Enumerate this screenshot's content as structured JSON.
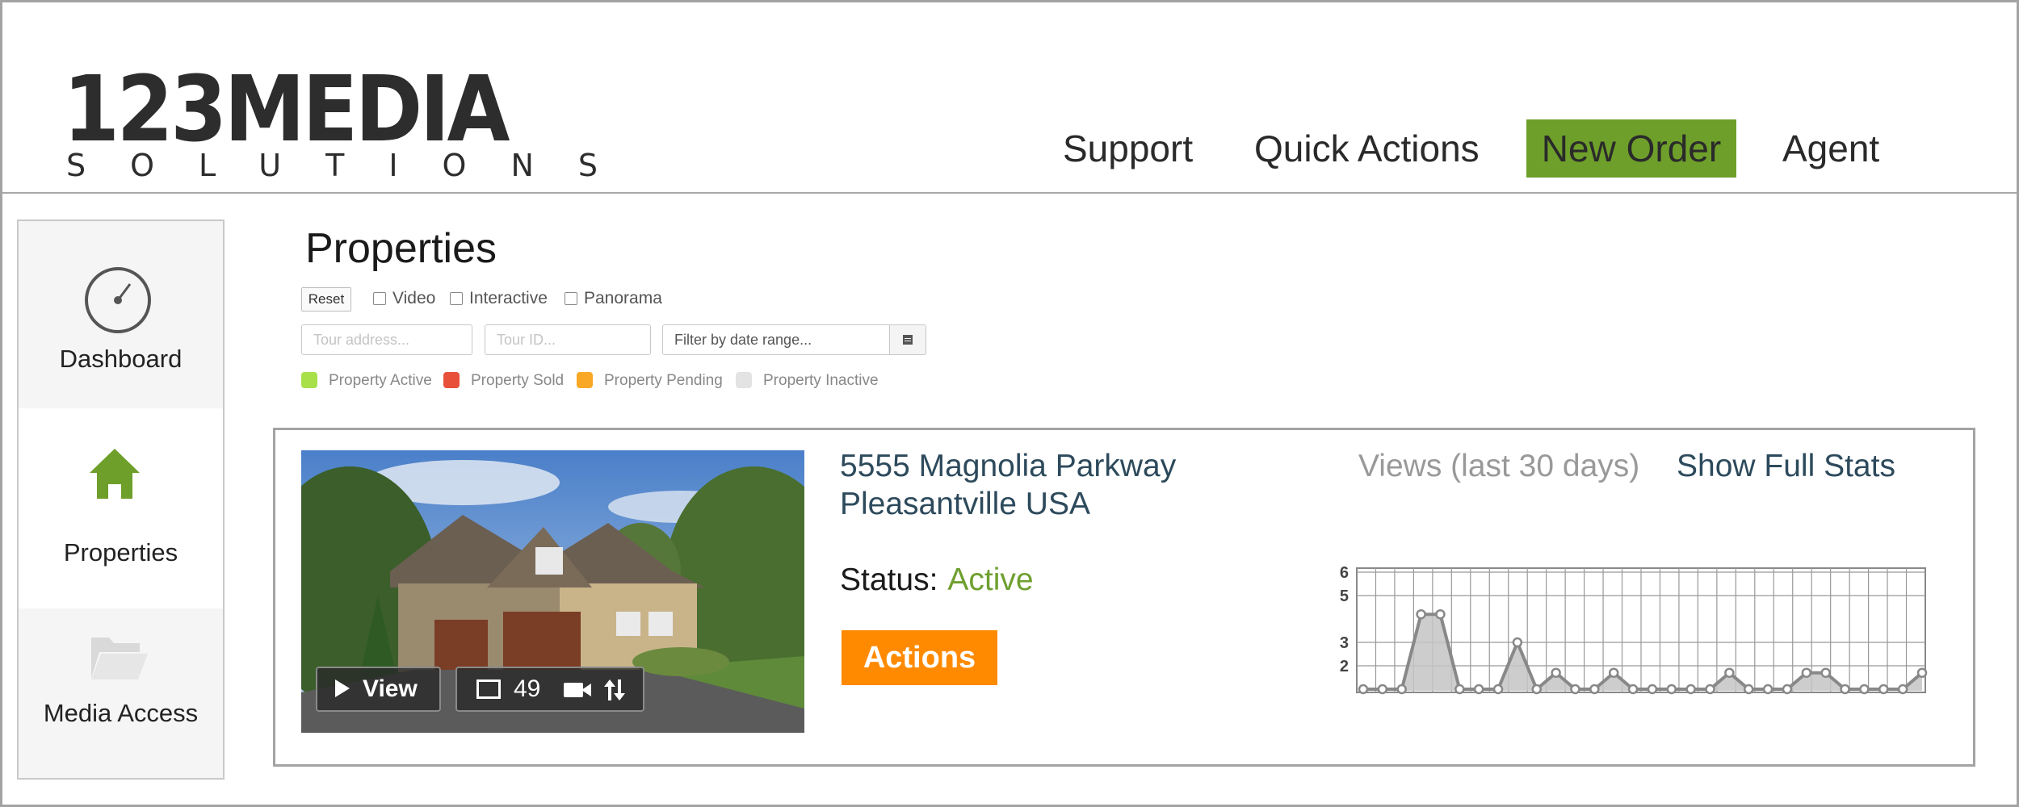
{
  "logo": {
    "top": "123MEDIA",
    "bottom": "SOLUTIONS"
  },
  "nav": {
    "support": "Support",
    "quick_actions": "Quick Actions",
    "new_order": "New Order",
    "agent": "Agent"
  },
  "sidebar": {
    "items": [
      {
        "label": "Dashboard"
      },
      {
        "label": "Properties"
      },
      {
        "label": "Media Access"
      }
    ]
  },
  "page": {
    "title": "Properties"
  },
  "filters": {
    "reset_label": "Reset",
    "checkboxes": [
      {
        "label": "Video",
        "checked": false
      },
      {
        "label": "Interactive",
        "checked": false
      },
      {
        "label": "Panorama",
        "checked": false
      }
    ],
    "address_placeholder": "Tour address...",
    "tourid_placeholder": "Tour ID...",
    "date_placeholder": "Filter by date range..."
  },
  "legend": [
    {
      "label": "Property Active",
      "color": "#a8e04a"
    },
    {
      "label": "Property Sold",
      "color": "#e8503a"
    },
    {
      "label": "Property Pending",
      "color": "#f9a825"
    },
    {
      "label": "Property Inactive",
      "color": "#e3e3e3"
    }
  ],
  "colors": {
    "brand_green": "#6e9f2a",
    "actions_orange": "#ff8a00",
    "status_active": "#6fa030",
    "link_blue": "#2d4a5c"
  },
  "property": {
    "address_line1": "5555 Magnolia Parkway",
    "address_line2": "Pleasantville USA",
    "status_label": "Status:",
    "status_value": "Active",
    "actions_label": "Actions",
    "view_label": "View",
    "image_count": "49",
    "views_title": "Views (last 30 days)",
    "full_stats_label": "Show Full Stats"
  },
  "chart_data": {
    "type": "area",
    "x": [
      1,
      2,
      3,
      4,
      5,
      6,
      7,
      8,
      9,
      10,
      11,
      12,
      13,
      14,
      15,
      16,
      17,
      18,
      19,
      20,
      21,
      22,
      23,
      24,
      25,
      26,
      27,
      28,
      29,
      30
    ],
    "series": [
      {
        "values": [
          1,
          1,
          1,
          4.2,
          4.2,
          1,
          1,
          1,
          3,
          1,
          1.7,
          1,
          1,
          1.7,
          1,
          1,
          1,
          1,
          1,
          1.7,
          1,
          1,
          1,
          1.7,
          1.7,
          1,
          1,
          1,
          1,
          1.7
        ]
      }
    ],
    "yticks": [
      2,
      3,
      5,
      6
    ],
    "ylim": [
      1,
      5
    ],
    "grid": true,
    "title": "",
    "xlabel": "",
    "ylabel": ""
  }
}
